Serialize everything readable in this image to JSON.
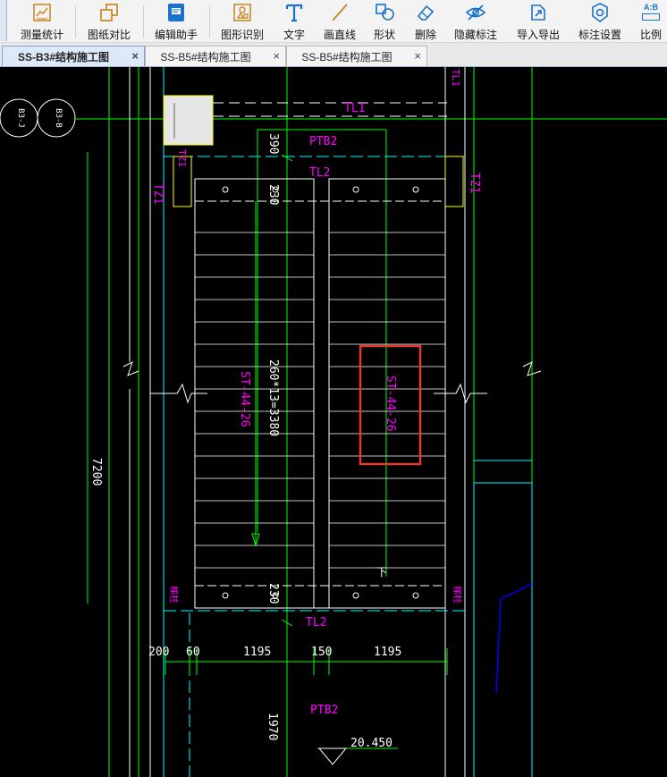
{
  "toolbar": {
    "items": [
      {
        "label": "测量统计",
        "icon": "measure-stats-icon"
      },
      {
        "label": "图纸对比",
        "icon": "drawing-compare-icon"
      },
      {
        "label": "编辑助手",
        "icon": "edit-assistant-icon"
      },
      {
        "label": "图形识别",
        "icon": "shape-recognition-icon"
      },
      {
        "label": "文字",
        "icon": "text-icon"
      },
      {
        "label": "画直线",
        "icon": "draw-line-icon"
      },
      {
        "label": "形状",
        "icon": "shape-icon"
      },
      {
        "label": "删除",
        "icon": "eraser-icon"
      },
      {
        "label": "隐藏标注",
        "icon": "hide-annotation-icon"
      },
      {
        "label": "导入导出",
        "icon": "import-export-icon"
      },
      {
        "label": "标注设置",
        "icon": "annotation-settings-icon"
      },
      {
        "label": "比例",
        "icon": "scale-icon"
      }
    ],
    "scale_icon_text": "A:B"
  },
  "tabs": [
    {
      "title": "SS-B3#结构施工图",
      "close": "×",
      "active": true
    },
    {
      "title": "SS-B5#结构施工图",
      "close": "×",
      "active": false
    },
    {
      "title": "SS-B5#结构施工图",
      "close": "×",
      "active": false
    }
  ],
  "drawing": {
    "axis_bubbles": [
      "B3-J",
      "B3-B"
    ],
    "beam_tl1": "TL1",
    "beam_tl2_top": "TL2",
    "beam_tl2_bottom": "TL2",
    "slab_ptb2_top": "PTB2",
    "slab_ptb2_bottom": "PTB2",
    "col_tz1_left": "TZ1",
    "col_tz1_right": "TZ1",
    "col_tz1_top": "TZ1",
    "right_edge_mark": "TL1",
    "dim_390": "390",
    "dim_230_top": "230",
    "dim_230_bottom": "230",
    "dim_flight": "260*13=3380",
    "flight_left_label": "ST-44-26",
    "flight_right_label": "ST-44-26",
    "dim_7200": "7200",
    "dim_200": "200",
    "dim_60": "60",
    "dim_1195_left": "1195",
    "dim_150": "150",
    "dim_1195_right": "1195",
    "dim_1970": "1970",
    "elevation": "20.450",
    "landing_mark_left": "梯柱",
    "landing_mark_right": "梯柱",
    "up_arrow": "下"
  },
  "colors": {
    "green": "#00ff00",
    "white": "#ffffff",
    "magenta": "#ff00ff",
    "cyan": "#00ffff",
    "blue": "#0000ff",
    "yellow": "#ffff00",
    "selection_red": "#e23b2e",
    "canvas_bg": "#000000"
  }
}
